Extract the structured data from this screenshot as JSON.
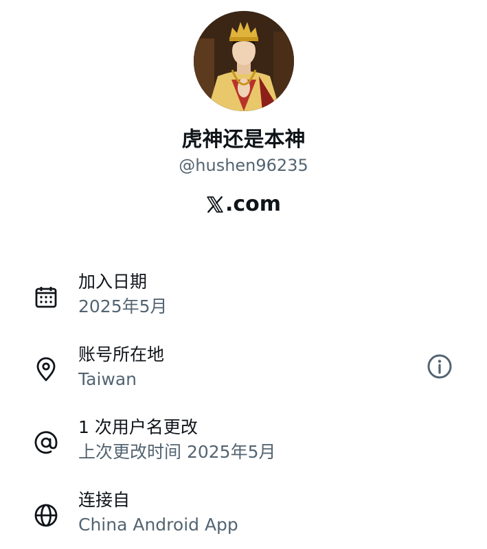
{
  "profile": {
    "display_name": "虎神还是本神",
    "handle": "@hushen96235",
    "avatar_icon": "profile-photo"
  },
  "brand": {
    "logo_icon": "x-logo-icon",
    "text": ".com"
  },
  "details": {
    "joined": {
      "icon": "calendar-icon",
      "title": "加入日期",
      "value": "2025年5月"
    },
    "location": {
      "icon": "location-pin-icon",
      "title": "账号所在地",
      "value": "Taiwan",
      "info_icon": "info-icon"
    },
    "username_changes": {
      "icon": "at-sign-icon",
      "title": "1 次用户名更改",
      "value": "上次更改时间 2025年5月"
    },
    "connected_via": {
      "icon": "globe-icon",
      "title": "连接自",
      "value": "China Android App"
    }
  },
  "colors": {
    "primary_text": "#0f1419",
    "secondary_text": "#536471"
  }
}
